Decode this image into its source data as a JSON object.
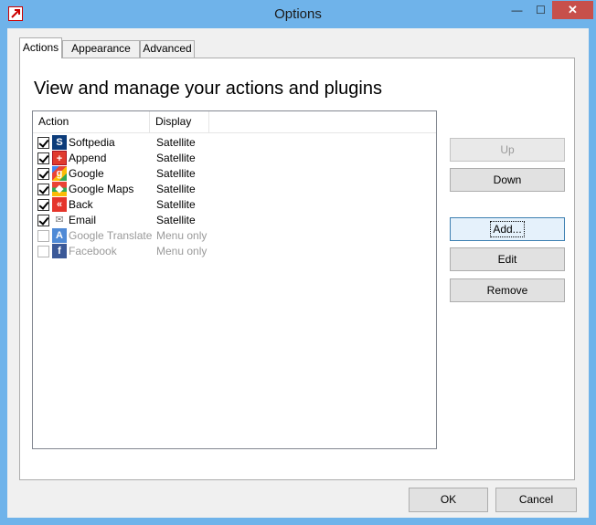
{
  "window": {
    "title": "Options",
    "minimize_glyph": "—",
    "maximize_glyph": "☐",
    "close_glyph": "✕"
  },
  "tabs": [
    {
      "label": "Actions",
      "active": true
    },
    {
      "label": "Appearance",
      "active": false
    },
    {
      "label": "Advanced",
      "active": false
    }
  ],
  "panel": {
    "heading": "View and manage your actions and plugins"
  },
  "list": {
    "columns": [
      "Action",
      "Display"
    ],
    "rows": [
      {
        "label": "Softpedia",
        "display": "Satellite",
        "checked": true,
        "icon": "softpedia-icon",
        "icon_glyph": "S"
      },
      {
        "label": "Append",
        "display": "Satellite",
        "checked": true,
        "icon": "append-icon",
        "icon_glyph": "+"
      },
      {
        "label": "Google",
        "display": "Satellite",
        "checked": true,
        "icon": "google-icon",
        "icon_glyph": "g"
      },
      {
        "label": "Google Maps",
        "display": "Satellite",
        "checked": true,
        "icon": "google-maps-icon",
        "icon_glyph": "◆"
      },
      {
        "label": "Back",
        "display": "Satellite",
        "checked": true,
        "icon": "back-icon",
        "icon_glyph": "«"
      },
      {
        "label": "Email",
        "display": "Satellite",
        "checked": true,
        "icon": "email-icon",
        "icon_glyph": "✉"
      },
      {
        "label": "Google Translate",
        "display": "Menu only",
        "checked": false,
        "icon": "google-translate-icon",
        "icon_glyph": "A"
      },
      {
        "label": "Facebook",
        "display": "Menu only",
        "checked": false,
        "icon": "facebook-icon",
        "icon_glyph": "f"
      }
    ]
  },
  "side_buttons": {
    "up": "Up",
    "down": "Down",
    "add": "Add...",
    "edit": "Edit",
    "remove": "Remove"
  },
  "footer": {
    "ok": "OK",
    "cancel": "Cancel"
  },
  "colors": {
    "titlebar": "#6fb3ea",
    "close_button": "#c7504b"
  }
}
